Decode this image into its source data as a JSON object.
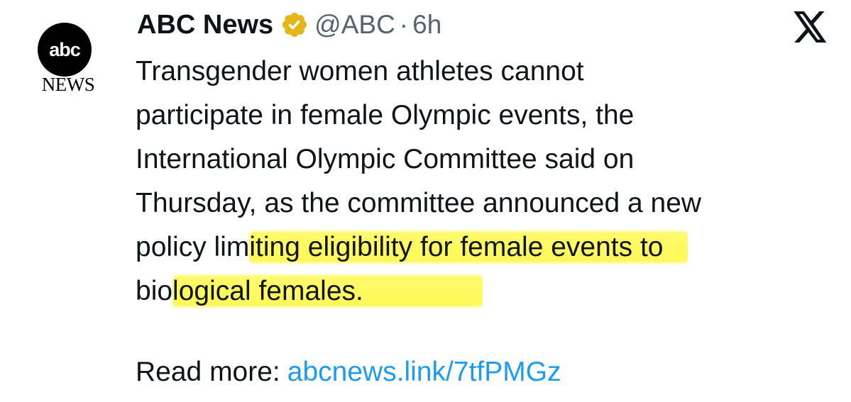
{
  "account": {
    "avatar_top": "abc",
    "avatar_bottom": "NEWS",
    "display_name": "ABC News",
    "handle": "@ABC",
    "separator": "·",
    "time": "6h",
    "verified_color": "#e2b719"
  },
  "platform": {
    "logo_icon": "x-logo-icon"
  },
  "tweet": {
    "line1": "Transgender women athletes cannot",
    "line2": "participate in female Olympic events, the",
    "line3": "International Olympic Committee said on",
    "line4": "Thursday, as the committee announced a new",
    "line5_plain": "policy lim",
    "line5_highlight": "iting eligibility for female events to",
    "line6_plain": "bio",
    "line6_highlight": "logical females.",
    "highlight_color": "#fff85a"
  },
  "read_more": {
    "label": "Read more:",
    "link_text": "abcnews.link/7tfPMGz",
    "link_color": "#1d9bf0"
  }
}
